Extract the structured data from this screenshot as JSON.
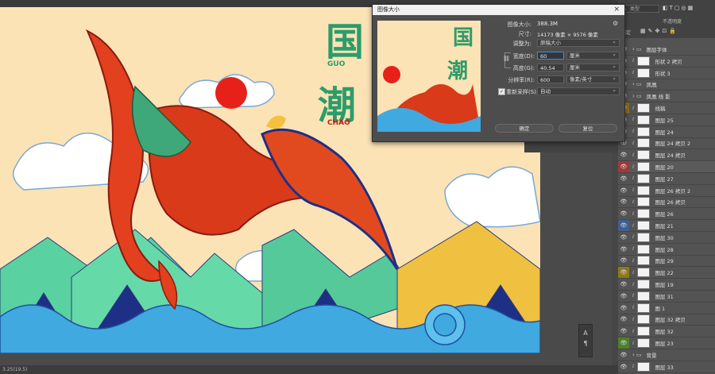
{
  "status_bar": {
    "zoom": "3.25(19.5)"
  },
  "artwork": {
    "title_chars": [
      "国",
      "潮"
    ],
    "latin": [
      "GUO",
      "CHAO"
    ]
  },
  "dialog": {
    "title": "图像大小",
    "close_label": "×",
    "image_size_label": "图像大小:",
    "image_size_value": "388.3M",
    "dimensions_label": "尺寸:",
    "dimensions_value": "14173 像素 × 9576 像素",
    "fit_label": "调整为:",
    "fit_value": "原稿大小",
    "width_label": "宽度(D):",
    "width_value": "60",
    "width_unit": "厘米",
    "height_label": "高度(G):",
    "height_value": "40.54",
    "height_unit": "厘米",
    "resolution_label": "分辨率(R):",
    "resolution_value": "600",
    "resolution_unit": "像素/英寸",
    "resample_label": "重新采样(S):",
    "resample_checked": true,
    "resample_value": "自动",
    "ok_label": "确定",
    "cancel_label": "复位"
  },
  "layers_panel": {
    "search_placeholder": "类型",
    "opacity_label": "不透明度",
    "lock_label": "锁定",
    "rows": [
      {
        "name": "图层字体",
        "kind": "group"
      },
      {
        "name": "形状 2 拷贝",
        "kind": "layer"
      },
      {
        "name": "形状 3",
        "kind": "layer"
      },
      {
        "name": "凤凰",
        "kind": "group"
      },
      {
        "name": "凤凰 线 影",
        "kind": "group"
      },
      {
        "name": "线稿",
        "kind": "layer"
      },
      {
        "name": "图层 25",
        "kind": "layer"
      },
      {
        "name": "图层 24",
        "kind": "layer"
      },
      {
        "name": "图层 24 拷贝 2",
        "kind": "layer"
      },
      {
        "name": "图层 24 拷贝",
        "kind": "layer"
      },
      {
        "name": "图层 20",
        "kind": "layer"
      },
      {
        "name": "图层 27",
        "kind": "layer"
      },
      {
        "name": "图层 26 拷贝 2",
        "kind": "layer"
      },
      {
        "name": "图层 26 拷贝",
        "kind": "layer"
      },
      {
        "name": "图层 26",
        "kind": "layer"
      },
      {
        "name": "图层 21",
        "kind": "layer"
      },
      {
        "name": "图层 30",
        "kind": "layer"
      },
      {
        "name": "图层 28",
        "kind": "layer"
      },
      {
        "name": "图层 29",
        "kind": "layer"
      },
      {
        "name": "图层 22",
        "kind": "layer"
      },
      {
        "name": "图层 19",
        "kind": "layer"
      },
      {
        "name": "图层 31",
        "kind": "layer"
      },
      {
        "name": "图 1",
        "kind": "layer"
      },
      {
        "name": "图层 32 拷贝",
        "kind": "layer"
      },
      {
        "name": "图层 32",
        "kind": "layer"
      },
      {
        "name": "图层 23",
        "kind": "layer"
      },
      {
        "name": "背景",
        "kind": "group"
      },
      {
        "name": "图层 33",
        "kind": "layer"
      }
    ]
  },
  "colors": {
    "canvas_bg": "#fbe3b6",
    "accent_focus": "#3d8ce0",
    "title_green": "#2c9c6a",
    "sun_red": "#e8201a"
  }
}
